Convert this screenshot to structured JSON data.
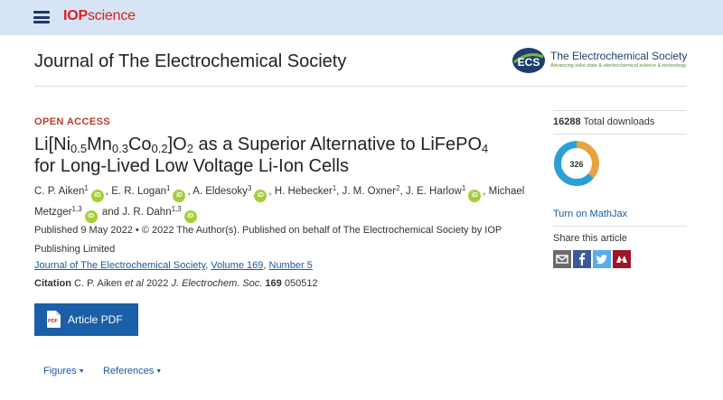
{
  "header": {
    "brand_iop": "IOP",
    "brand_science": "science",
    "menu_icon": "hamburger-menu-icon"
  },
  "journal": {
    "title": "Journal of The Electrochemical Society",
    "society_logo_initials": "ECS",
    "society_name": "The Electrochemical Society",
    "society_tagline": "Advancing solid state & electrochemical science & technology"
  },
  "article": {
    "access_label": "OPEN ACCESS",
    "title_parts": {
      "a": "Li[Ni",
      "s1": "0.5",
      "b": "Mn",
      "s2": "0.3",
      "c": "Co",
      "s3": "0.2",
      "d": "]O",
      "s4": "2",
      "e": " as a Superior Alternative to LiFePO",
      "s5": "4",
      "f": " for Long-Lived Low Voltage Li-Ion Cells"
    },
    "authors": [
      {
        "name": "C. P. Aiken",
        "aff": "1"
      },
      {
        "name": "E. R. Logan",
        "aff": "1"
      },
      {
        "name": "A. Eldesoky",
        "aff": "3"
      },
      {
        "name": "H. Hebecker",
        "aff": "1"
      },
      {
        "name": "J. M. Oxner",
        "aff": "2"
      },
      {
        "name": "J. E. Harlow",
        "aff": "1"
      },
      {
        "name": "Michael Metzger",
        "aff": "1,3"
      },
      {
        "name": "J. R. Dahn",
        "aff": "1,3"
      }
    ],
    "orcid_label": "iD",
    "and_word": "and",
    "published_text": "Published 9 May 2022 • © 2022 The Author(s). Published on behalf of The Electrochemical Society by IOP Publishing Limited",
    "volume_journal_link": "Journal of The Electrochemical Society",
    "volume_link": "Volume 169",
    "number_link": "Number 5",
    "citation": {
      "label": "Citation",
      "authors": "C. P. Aiken",
      "et_al": "et al",
      "year": "2022",
      "journal_abbrev": "J. Electrochem. Soc.",
      "volume": "169",
      "article_number": "050512"
    },
    "pdf_button_label": "Article PDF",
    "pdf_icon_text": "PDF"
  },
  "nav": {
    "figures_label": "Figures",
    "references_label": "References"
  },
  "sidebar": {
    "downloads_count": "16288",
    "downloads_label": "Total downloads",
    "altmetric_score": "326",
    "mathjax_label": "Turn on MathJax",
    "share_label": "Share this article",
    "share_icons": [
      "email-icon",
      "facebook-icon",
      "twitter-icon",
      "mendeley-icon"
    ]
  },
  "colors": {
    "topbar_bg": "#d6e4f5",
    "brand_red": "#d9201f",
    "link_blue": "#1a5a9c",
    "button_blue": "#1a5fa8",
    "open_access_red": "#c0392b",
    "orcid_green": "#a6ce39"
  }
}
